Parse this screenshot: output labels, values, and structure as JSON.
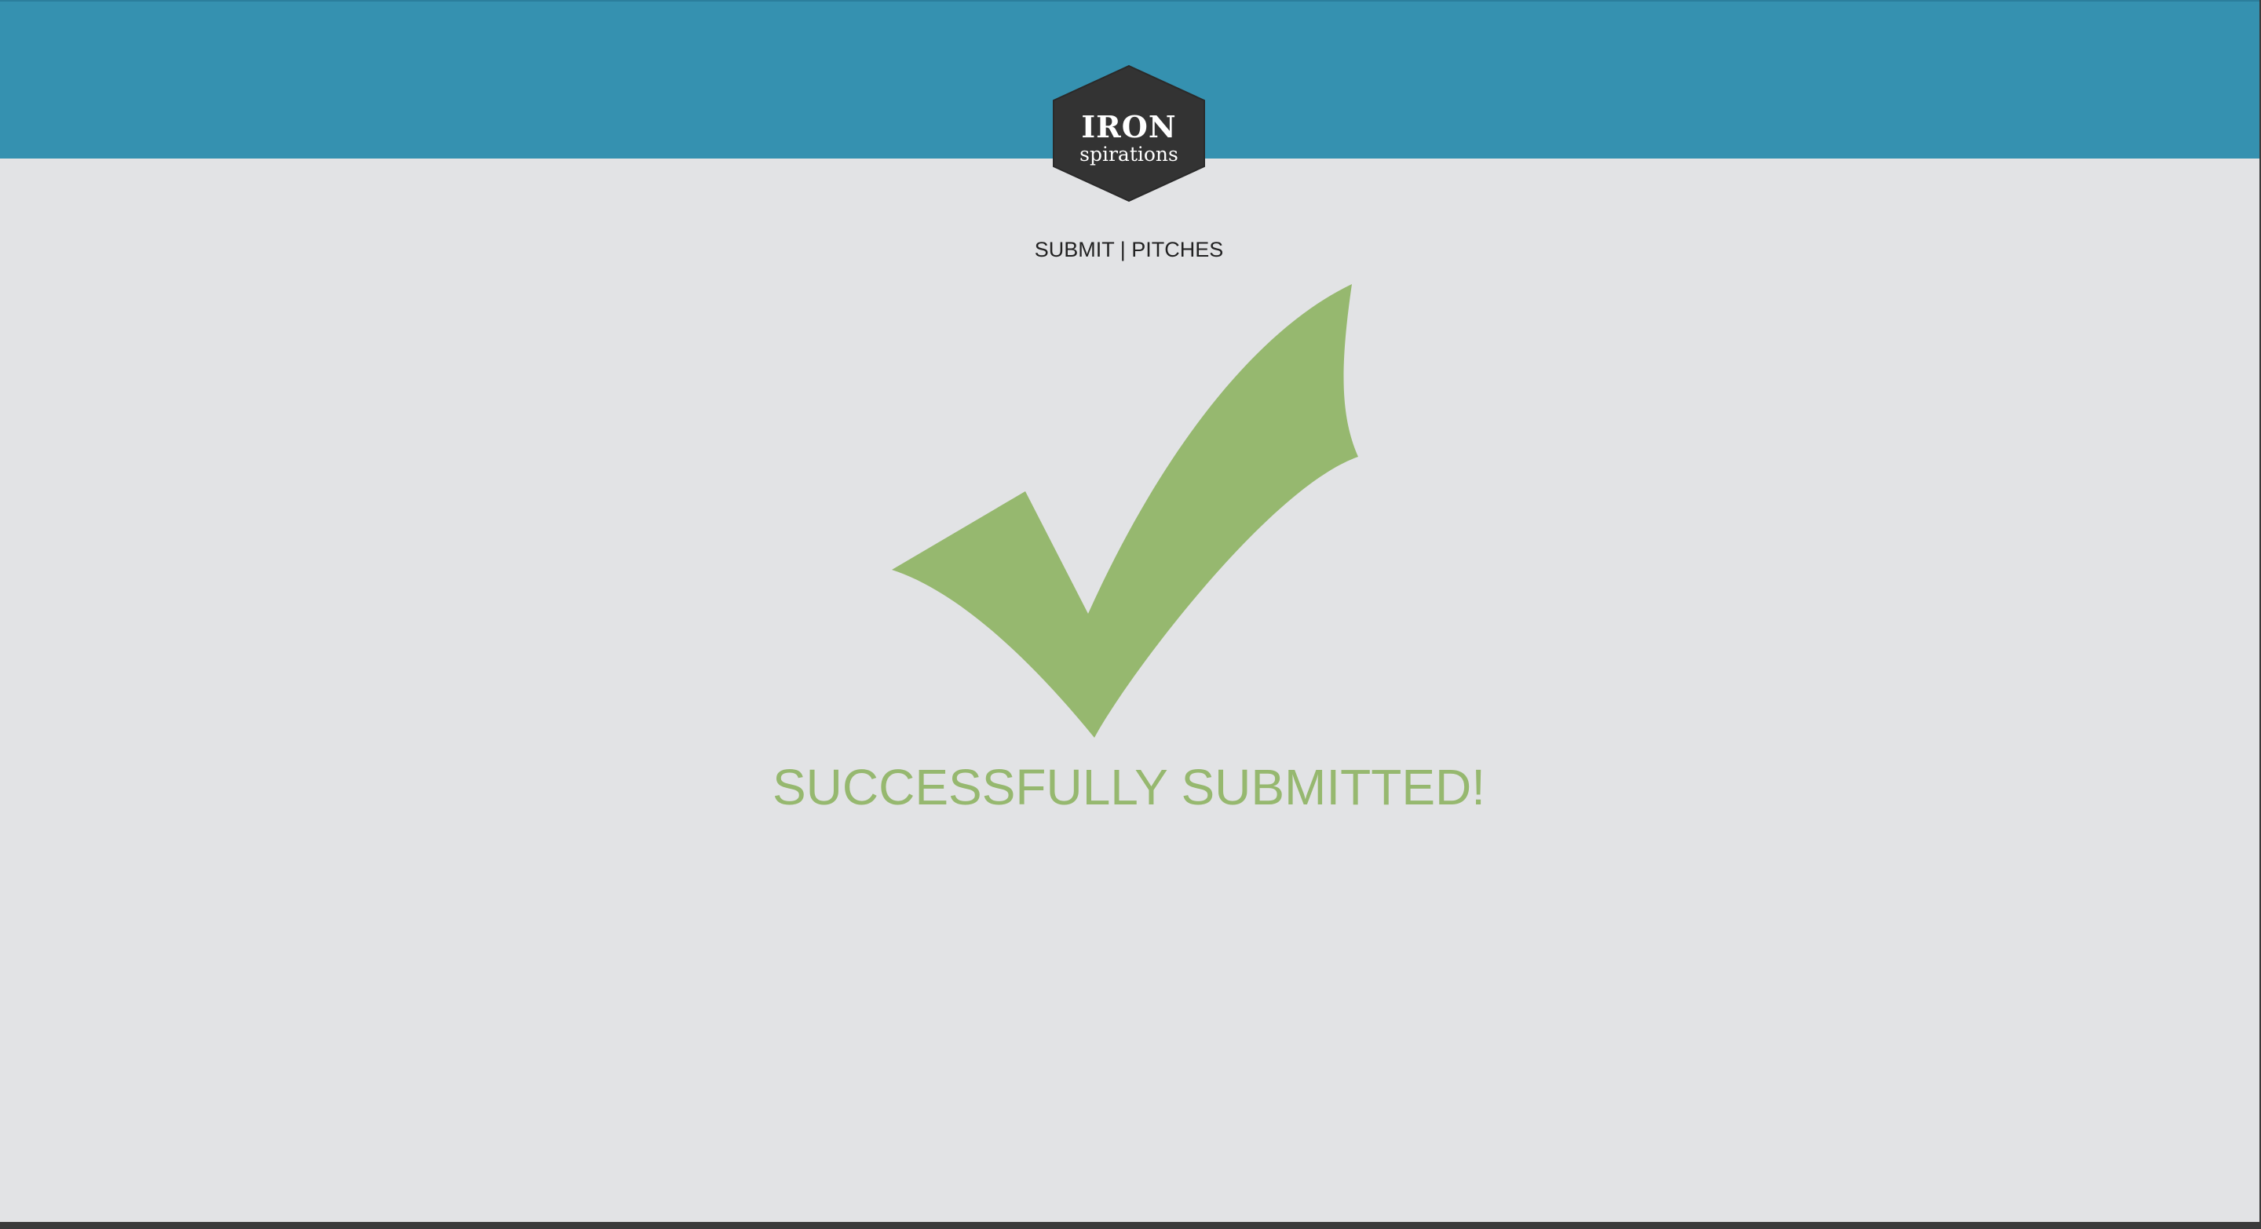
{
  "logo": {
    "line1": "IRON",
    "line2": "spirations"
  },
  "nav": {
    "submit_label": "SUBMIT",
    "separator": "|",
    "pitches_label": "PITCHES"
  },
  "status": {
    "message": "SUCCESSFULLY SUBMITTED!",
    "icon": "checkmark-icon"
  },
  "colors": {
    "header": "#3591b0",
    "background": "#e2e3e5",
    "accent_green": "#96b86f",
    "logo_dark": "#333333"
  }
}
